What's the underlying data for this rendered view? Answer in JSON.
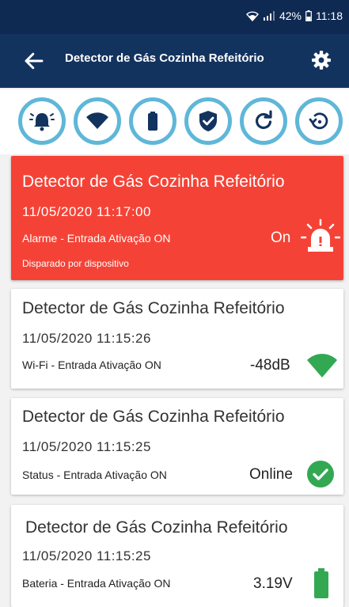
{
  "status_bar": {
    "battery": "42%",
    "time": "11:18"
  },
  "header": {
    "title": "Detector de Gás Cozinha Refeitório"
  },
  "toolbar": {
    "buttons": [
      "alarm-bell-icon",
      "wifi-icon",
      "battery-icon",
      "shield-check-icon",
      "refresh-icon",
      "history-icon"
    ]
  },
  "events": [
    {
      "title": "Detector de Gás Cozinha Refeitório",
      "datetime": "11/05/2020  11:17:00",
      "type": "Alarme",
      "detail": " - Entrada Ativação ON",
      "value": "On",
      "note": "Disparado por dispositivo",
      "icon": "siren-icon"
    },
    {
      "title": "Detector de Gás Cozinha Refeitório",
      "datetime": "11/05/2020  11:15:26",
      "type": "Wi-Fi",
      "detail": " - Entrada Ativação ON",
      "value": "-48dB",
      "icon": "wifi-signal-icon"
    },
    {
      "title": "Detector de Gás Cozinha Refeitório",
      "datetime": "11/05/2020  11:15:25",
      "type": "Status",
      "detail": " - Entrada Ativação ON",
      "value": "Online",
      "icon": "check-circle-icon"
    },
    {
      "title": "Detector de Gás Cozinha Refeitório",
      "datetime": "11/05/2020  11:15:25",
      "type": "Bateria",
      "detail": " - Entrada Ativação ON",
      "value": "3.19V",
      "icon": "battery-full-icon"
    }
  ],
  "colors": {
    "navy": "#13335f",
    "alarm_red": "#f44336",
    "accent_blue": "#5fb7d8",
    "green": "#33a853"
  }
}
